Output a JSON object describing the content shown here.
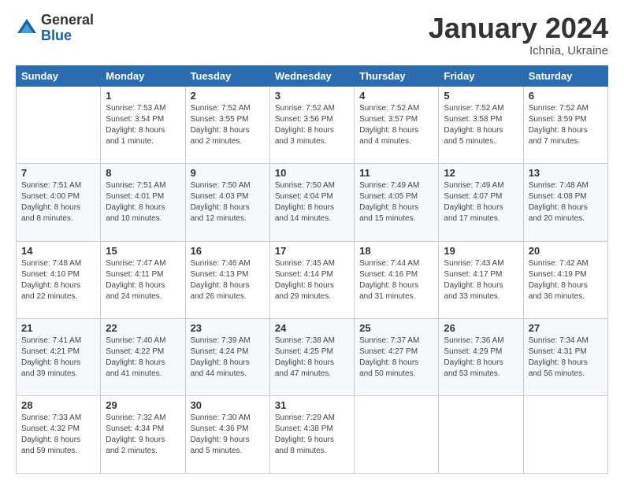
{
  "header": {
    "logo_general": "General",
    "logo_blue": "Blue",
    "month_title": "January 2024",
    "location": "Ichnia, Ukraine"
  },
  "weekdays": [
    "Sunday",
    "Monday",
    "Tuesday",
    "Wednesday",
    "Thursday",
    "Friday",
    "Saturday"
  ],
  "weeks": [
    [
      {
        "day": "",
        "info": ""
      },
      {
        "day": "1",
        "info": "Sunrise: 7:53 AM\nSunset: 3:54 PM\nDaylight: 8 hours\nand 1 minute."
      },
      {
        "day": "2",
        "info": "Sunrise: 7:52 AM\nSunset: 3:55 PM\nDaylight: 8 hours\nand 2 minutes."
      },
      {
        "day": "3",
        "info": "Sunrise: 7:52 AM\nSunset: 3:56 PM\nDaylight: 8 hours\nand 3 minutes."
      },
      {
        "day": "4",
        "info": "Sunrise: 7:52 AM\nSunset: 3:57 PM\nDaylight: 8 hours\nand 4 minutes."
      },
      {
        "day": "5",
        "info": "Sunrise: 7:52 AM\nSunset: 3:58 PM\nDaylight: 8 hours\nand 5 minutes."
      },
      {
        "day": "6",
        "info": "Sunrise: 7:52 AM\nSunset: 3:59 PM\nDaylight: 8 hours\nand 7 minutes."
      }
    ],
    [
      {
        "day": "7",
        "info": "Sunrise: 7:51 AM\nSunset: 4:00 PM\nDaylight: 8 hours\nand 8 minutes."
      },
      {
        "day": "8",
        "info": "Sunrise: 7:51 AM\nSunset: 4:01 PM\nDaylight: 8 hours\nand 10 minutes."
      },
      {
        "day": "9",
        "info": "Sunrise: 7:50 AM\nSunset: 4:03 PM\nDaylight: 8 hours\nand 12 minutes."
      },
      {
        "day": "10",
        "info": "Sunrise: 7:50 AM\nSunset: 4:04 PM\nDaylight: 8 hours\nand 14 minutes."
      },
      {
        "day": "11",
        "info": "Sunrise: 7:49 AM\nSunset: 4:05 PM\nDaylight: 8 hours\nand 15 minutes."
      },
      {
        "day": "12",
        "info": "Sunrise: 7:49 AM\nSunset: 4:07 PM\nDaylight: 8 hours\nand 17 minutes."
      },
      {
        "day": "13",
        "info": "Sunrise: 7:48 AM\nSunset: 4:08 PM\nDaylight: 8 hours\nand 20 minutes."
      }
    ],
    [
      {
        "day": "14",
        "info": "Sunrise: 7:48 AM\nSunset: 4:10 PM\nDaylight: 8 hours\nand 22 minutes."
      },
      {
        "day": "15",
        "info": "Sunrise: 7:47 AM\nSunset: 4:11 PM\nDaylight: 8 hours\nand 24 minutes."
      },
      {
        "day": "16",
        "info": "Sunrise: 7:46 AM\nSunset: 4:13 PM\nDaylight: 8 hours\nand 26 minutes."
      },
      {
        "day": "17",
        "info": "Sunrise: 7:45 AM\nSunset: 4:14 PM\nDaylight: 8 hours\nand 29 minutes."
      },
      {
        "day": "18",
        "info": "Sunrise: 7:44 AM\nSunset: 4:16 PM\nDaylight: 8 hours\nand 31 minutes."
      },
      {
        "day": "19",
        "info": "Sunrise: 7:43 AM\nSunset: 4:17 PM\nDaylight: 8 hours\nand 33 minutes."
      },
      {
        "day": "20",
        "info": "Sunrise: 7:42 AM\nSunset: 4:19 PM\nDaylight: 8 hours\nand 36 minutes."
      }
    ],
    [
      {
        "day": "21",
        "info": "Sunrise: 7:41 AM\nSunset: 4:21 PM\nDaylight: 8 hours\nand 39 minutes."
      },
      {
        "day": "22",
        "info": "Sunrise: 7:40 AM\nSunset: 4:22 PM\nDaylight: 8 hours\nand 41 minutes."
      },
      {
        "day": "23",
        "info": "Sunrise: 7:39 AM\nSunset: 4:24 PM\nDaylight: 8 hours\nand 44 minutes."
      },
      {
        "day": "24",
        "info": "Sunrise: 7:38 AM\nSunset: 4:25 PM\nDaylight: 8 hours\nand 47 minutes."
      },
      {
        "day": "25",
        "info": "Sunrise: 7:37 AM\nSunset: 4:27 PM\nDaylight: 8 hours\nand 50 minutes."
      },
      {
        "day": "26",
        "info": "Sunrise: 7:36 AM\nSunset: 4:29 PM\nDaylight: 8 hours\nand 53 minutes."
      },
      {
        "day": "27",
        "info": "Sunrise: 7:34 AM\nSunset: 4:31 PM\nDaylight: 8 hours\nand 56 minutes."
      }
    ],
    [
      {
        "day": "28",
        "info": "Sunrise: 7:33 AM\nSunset: 4:32 PM\nDaylight: 8 hours\nand 59 minutes."
      },
      {
        "day": "29",
        "info": "Sunrise: 7:32 AM\nSunset: 4:34 PM\nDaylight: 9 hours\nand 2 minutes."
      },
      {
        "day": "30",
        "info": "Sunrise: 7:30 AM\nSunset: 4:36 PM\nDaylight: 9 hours\nand 5 minutes."
      },
      {
        "day": "31",
        "info": "Sunrise: 7:29 AM\nSunset: 4:38 PM\nDaylight: 9 hours\nand 8 minutes."
      },
      {
        "day": "",
        "info": ""
      },
      {
        "day": "",
        "info": ""
      },
      {
        "day": "",
        "info": ""
      }
    ]
  ]
}
